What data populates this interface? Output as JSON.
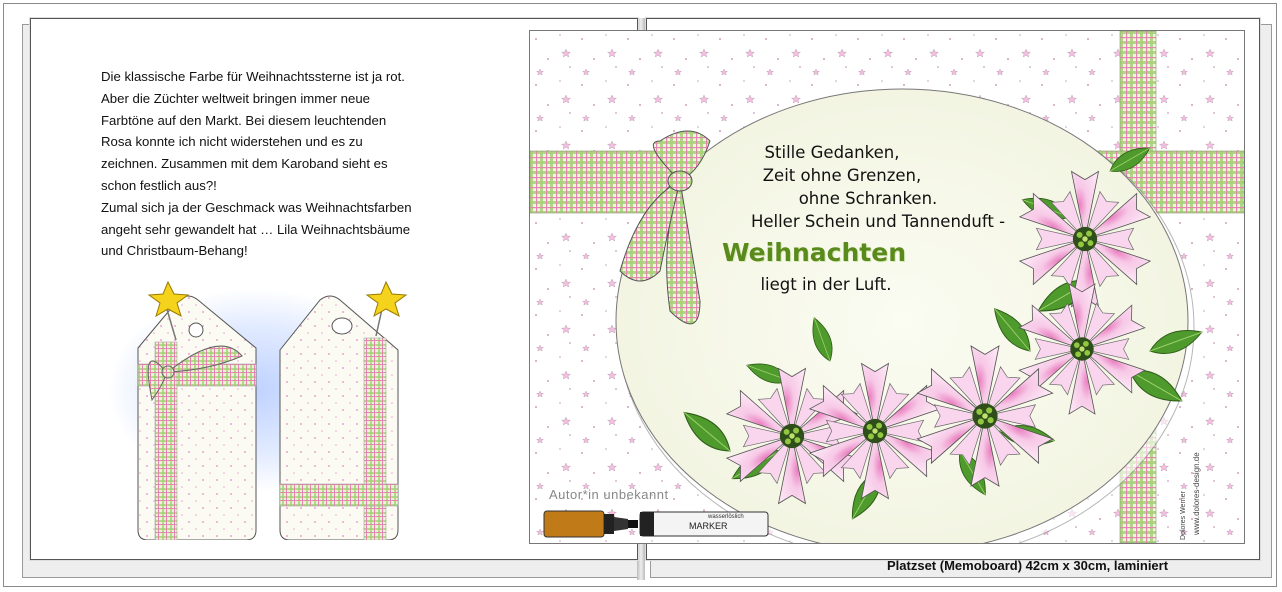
{
  "intro_text": {
    "line1": "Die klassische Farbe für Weihnachtssterne ist ja rot.",
    "line2": "Aber die Züchter weltweit bringen immer neue",
    "line3": "Farbtöne auf den Markt. Bei diesem leuchtenden",
    "line4": "Rosa konnte ich nicht widerstehen und es zu",
    "line5": "zeichnen. Zusammen mit dem Karoband sieht es",
    "line6": "schon festlich aus?!",
    "line7": "Zumal sich ja der Geschmack was Weihnachtsfarben",
    "line8": "angeht sehr gewandelt hat … Lila Weihnachtsbäume",
    "line9": "und Christbaum-Behang!"
  },
  "verse": {
    "line1": "Stille Gedanken,",
    "line2": "Zeit ohne Grenzen,",
    "line3": "ohne Schranken.",
    "line4": "Heller Schein und Tannenduft -",
    "line5": "Weihnachten",
    "line6": "liegt in der Luft."
  },
  "author_note": "Autor*in  unbekannt",
  "marker": {
    "label": "MARKER",
    "small": "wasserlöslich"
  },
  "signature": {
    "name": "Dolores Werner",
    "site": "www.dolores-design.de"
  },
  "caption": "Platzset (Memoboard) 42cm x 30cm, laminiert",
  "colors": {
    "plaid_green": "#a8cf7a",
    "plaid_pink": "#e586b0",
    "poinsettia_pink": "#f5c6e6",
    "leaf_green": "#4f9a2c",
    "title_green": "#5a8a1c",
    "star_yellow": "#f5d21c"
  }
}
